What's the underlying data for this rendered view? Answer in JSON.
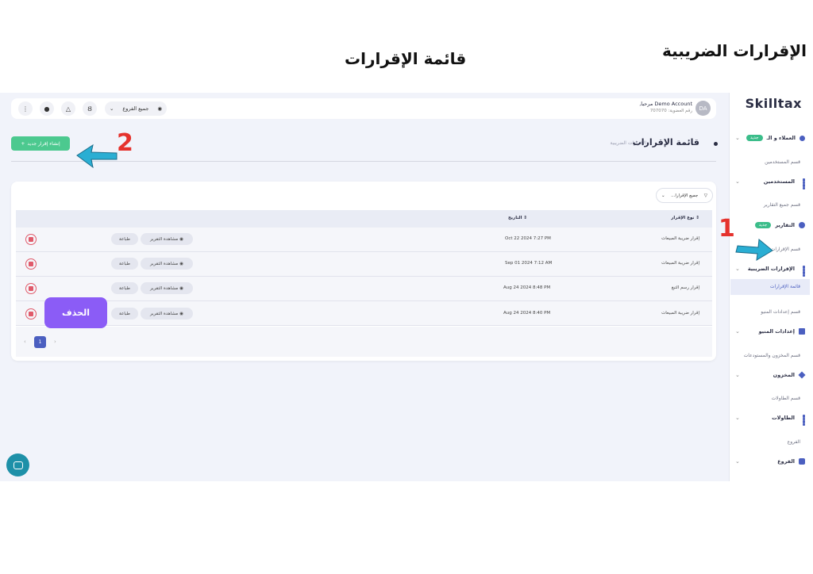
{
  "headings": {
    "right": "الإقرارات الضريبية",
    "center": "قائمة الإقرارات"
  },
  "sidebar": {
    "logo": "Skilltax",
    "sections": [
      {
        "label": "قسم المستخدمين",
        "item": "المستخدمين"
      },
      {
        "label": "قسم جميع التقارير",
        "item": "التقارير",
        "badge": "جديد"
      },
      {
        "label": "قسم الإقرارات",
        "item": "الإقرارات الضريبية",
        "sub": "قائمة الإقرارات"
      },
      {
        "label": "قسم إعدادات المنيو",
        "item": "إعدادات المنيو"
      },
      {
        "label": "قسم المخزون والمستودعات",
        "item": "المخزون"
      },
      {
        "label": "قسم الطاولات",
        "item": "الطاولات"
      },
      {
        "label": "الفروع",
        "item": "الفروع"
      }
    ],
    "top_item": "العملاء و الـ",
    "top_badge": "جديد"
  },
  "topbar": {
    "branch": "جميع الفروع",
    "avatar": "DA",
    "welcome": "Demo Account مرحبا,",
    "member": "رقم العضوية: 707070"
  },
  "page": {
    "title": "قائمة الإقرارات",
    "breadcrumb": "الإقرارات الضريبية",
    "create_button": "إنشاء إقرار جديد",
    "filter": "جميع الإقرارا..."
  },
  "table": {
    "headers": {
      "type": "نوع الإقرار",
      "date": "التاريخ"
    },
    "view_label": "مشاهدة التقرير",
    "print_label": "طباعة",
    "rows": [
      {
        "type": "إقرار ضريبة المبيعات",
        "date": "Oct 22 2024 7:27 PM"
      },
      {
        "type": "إقرار ضريبة المبيعات",
        "date": "Sep 01 2024 7:12 AM"
      },
      {
        "type": "إقرار رسم التبغ",
        "date": "Aug 24 2024 8:48 PM"
      },
      {
        "type": "إقرار ضريبة المبيعات",
        "date": "Aug 24 2024 8:40 PM"
      }
    ],
    "page": "1"
  },
  "callouts": {
    "delete": "الحذف",
    "step1": "1",
    "step2": "2"
  },
  "colors": {
    "accent": "#4b5fc0",
    "green": "#4cc98f",
    "arrow": "#2aaed3",
    "step": "#e5322d"
  }
}
